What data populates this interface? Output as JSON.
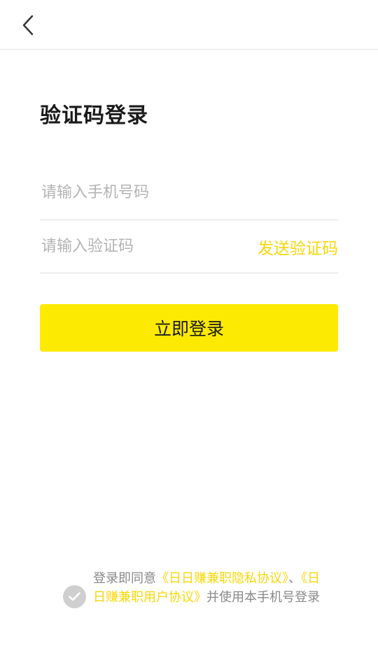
{
  "nav": {
    "back_icon": "chevron-left-icon"
  },
  "title": "验证码登录",
  "phone_input": {
    "value": "",
    "placeholder": "请输入手机号码"
  },
  "code_input": {
    "value": "",
    "placeholder": "请输入验证码"
  },
  "send_code_label": "发送验证码",
  "login_button_label": "立即登录",
  "agreement": {
    "prefix": "登录即同意",
    "privacy_link": "《日日赚兼职隐私协议》",
    "separator": "、",
    "user_link": "《日日赚兼职用户协议》",
    "suffix": "并使用本手机号登录",
    "check_icon": "checkmark-icon"
  },
  "colors": {
    "accent_yellow": "#fdea03",
    "link_yellow": "#f7d708",
    "placeholder_gray": "#b3b3b3",
    "divider": "#dcdcdc",
    "check_gray": "#cfcfcf"
  }
}
